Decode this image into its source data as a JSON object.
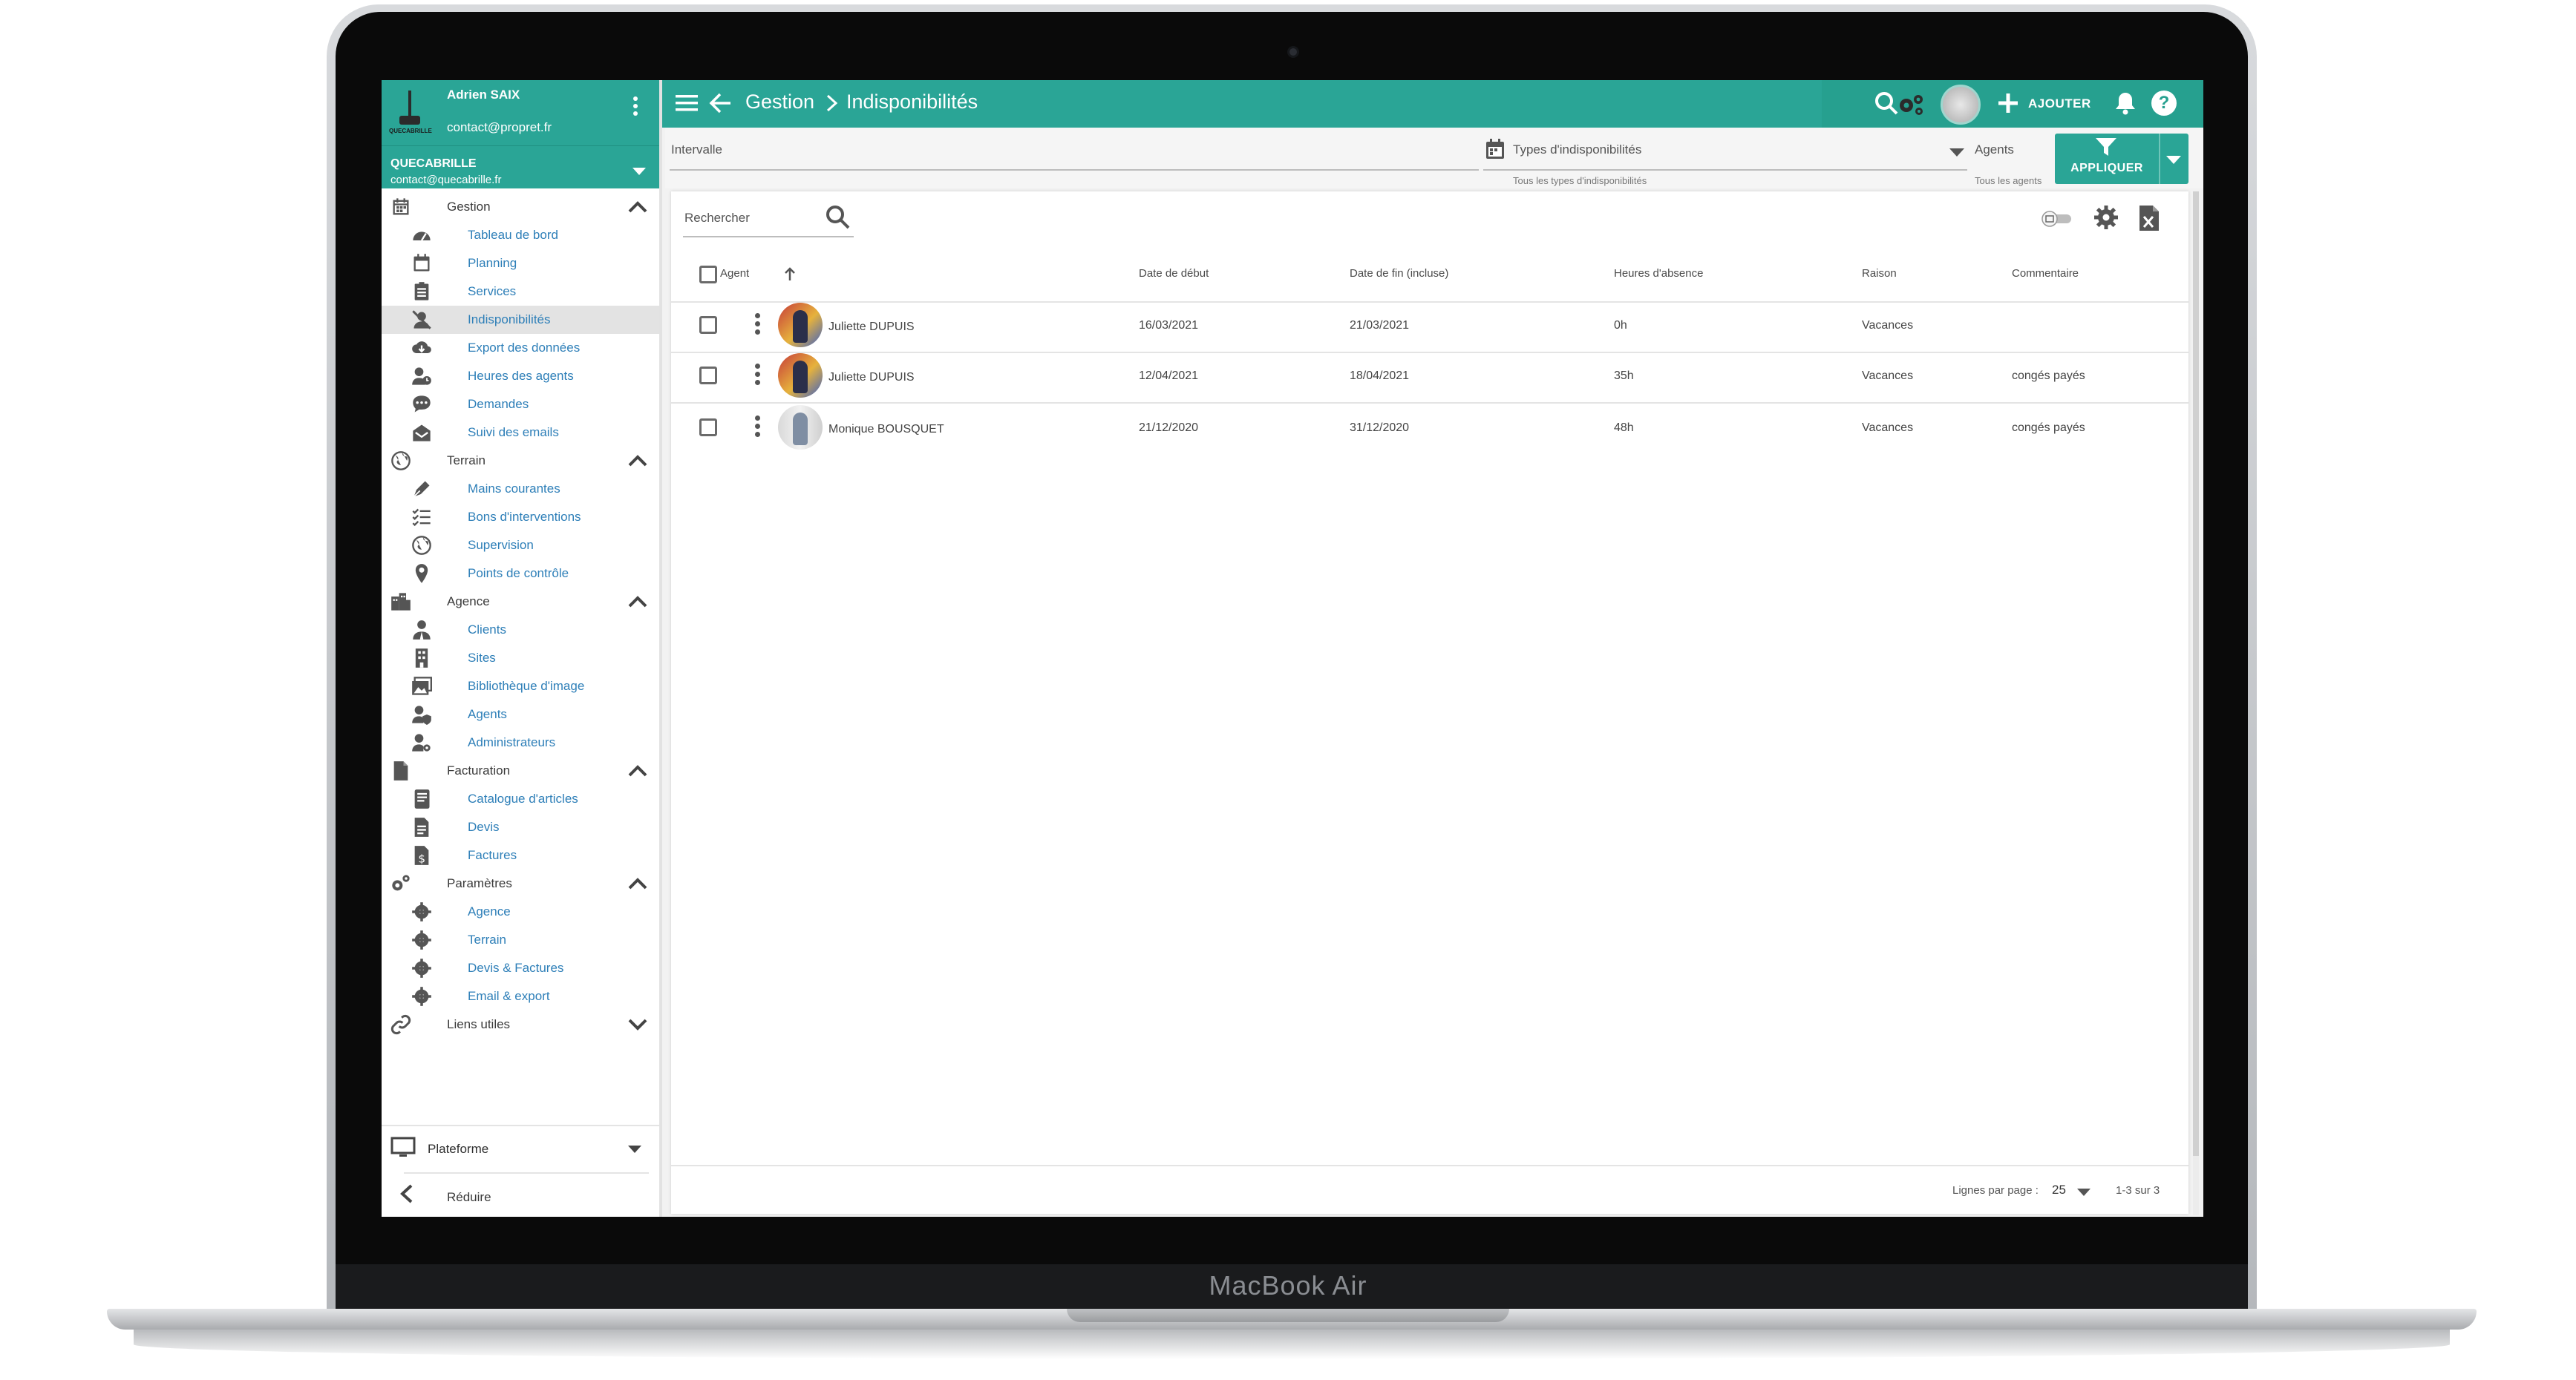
{
  "device": {
    "brand": "MacBook Air"
  },
  "user": {
    "name": "Adrien SAIX",
    "email": "contact@propret.fr"
  },
  "company": {
    "name": "QUECABRILLE",
    "email": "contact@quecabrille.fr",
    "logo_text": "QUECABRILLE"
  },
  "nav": {
    "gestion": {
      "label": "Gestion",
      "items": [
        "Tableau de bord",
        "Planning",
        "Services",
        "Indisponibilités",
        "Export des données",
        "Heures des agents",
        "Demandes",
        "Suivi des emails"
      ]
    },
    "terrain": {
      "label": "Terrain",
      "items": [
        "Mains courantes",
        "Bons d'interventions",
        "Supervision",
        "Points de contrôle"
      ]
    },
    "agence": {
      "label": "Agence",
      "items": [
        "Clients",
        "Sites",
        "Bibliothèque d'image",
        "Agents",
        "Administrateurs"
      ]
    },
    "facturation": {
      "label": "Facturation",
      "items": [
        "Catalogue d'articles",
        "Devis",
        "Factures"
      ]
    },
    "parametres": {
      "label": "Paramètres",
      "items": [
        "Agence",
        "Terrain",
        "Devis & Factures",
        "Email & export"
      ]
    },
    "liens": {
      "label": "Liens utiles"
    },
    "active": "Indisponibilités"
  },
  "sidebar_footer": {
    "platform": "Plateforme",
    "reduce": "Réduire"
  },
  "topbar": {
    "breadcrumb": [
      "Gestion",
      "Indisponibilités"
    ],
    "add_label": "AJOUTER",
    "help_glyph": "?"
  },
  "filters": {
    "interval_label": "Intervalle",
    "types_label": "Types d'indisponibilités",
    "types_hint": "Tous les types d'indisponibilités",
    "agents_label": "Agents",
    "agents_hint": "Tous les agents",
    "apply_label": "APPLIQUER"
  },
  "table": {
    "search_placeholder": "Rechercher",
    "columns": [
      "Agent",
      "Date de début",
      "Date de fin (incluse)",
      "Heures d'absence",
      "Raison",
      "Commentaire"
    ],
    "rows": [
      {
        "agent": "Juliette DUPUIS",
        "start": "16/03/2021",
        "end": "21/03/2021",
        "hours": "0h",
        "reason": "Vacances",
        "comment": ""
      },
      {
        "agent": "Juliette DUPUIS",
        "start": "12/04/2021",
        "end": "18/04/2021",
        "hours": "35h",
        "reason": "Vacances",
        "comment": "congés payés"
      },
      {
        "agent": "Monique BOUSQUET",
        "start": "21/12/2020",
        "end": "31/12/2020",
        "hours": "48h",
        "reason": "Vacances",
        "comment": "congés payés"
      }
    ],
    "rows_per_page_label": "Lignes par page :",
    "rows_per_page": "25",
    "range": "1-3 sur 3"
  },
  "colors": {
    "primary": "#2aa596",
    "link": "#2e7fb8",
    "active_bg": "#e3e3e3"
  },
  "icons": {
    "topbar": [
      "menu-icon",
      "back-icon",
      "search-icon",
      "gears-icon",
      "avatar",
      "plus-icon",
      "bell-icon",
      "help-icon"
    ],
    "toolbar": [
      "toggle-icon",
      "settings-icon",
      "excel-export-icon"
    ]
  }
}
